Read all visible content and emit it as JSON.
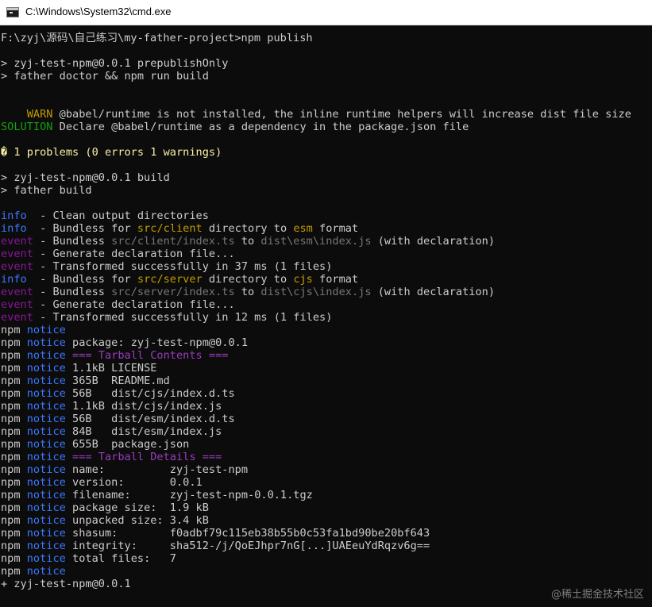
{
  "window": {
    "title": "C:\\Windows\\System32\\cmd.exe",
    "icon": "cmd-app-icon"
  },
  "colors": {
    "default": "#cccccc",
    "info": "#3b78ff",
    "event": "#881798",
    "warn": "#c19c00",
    "solution": "#13a10e",
    "notice": "#3b78ff",
    "tarball": "#9a3bbf",
    "path": "#767676",
    "warn_icon": "#f9f1a5"
  },
  "terminal": {
    "lines": [
      [
        {
          "t": "F:\\zyj\\源码\\自己练习\\my-father-project>npm publish"
        }
      ],
      [],
      [
        {
          "t": "> zyj-test-npm@0.0.1 prepublishOnly"
        }
      ],
      [
        {
          "t": "> father doctor && npm run build"
        }
      ],
      [],
      [],
      [
        {
          "t": "    WARN",
          "c": "warn"
        },
        {
          "t": " @babel/runtime is not installed, the inline runtime helpers will increase dist file size"
        }
      ],
      [
        {
          "t": "SOLUTION",
          "c": "solution"
        },
        {
          "t": " Declare @babel/runtime as a dependency in the package.json file"
        }
      ],
      [],
      [
        {
          "t": "�",
          "c": "warn_icon"
        },
        {
          "t": " 1 problems (0 errors 1 warnings)",
          "c": "warn_icon"
        }
      ],
      [],
      [
        {
          "t": "> zyj-test-npm@0.0.1 build"
        }
      ],
      [
        {
          "t": "> father build"
        }
      ],
      [],
      [
        {
          "t": "info",
          "c": "info"
        },
        {
          "t": "  - Clean output directories"
        }
      ],
      [
        {
          "t": "info",
          "c": "info"
        },
        {
          "t": "  - Bundless for "
        },
        {
          "t": "src/client",
          "c": "warn"
        },
        {
          "t": " directory to "
        },
        {
          "t": "esm",
          "c": "warn"
        },
        {
          "t": " format"
        }
      ],
      [
        {
          "t": "event",
          "c": "event"
        },
        {
          "t": " - Bundless "
        },
        {
          "t": "src/client/index.ts",
          "c": "path"
        },
        {
          "t": " to "
        },
        {
          "t": "dist\\esm\\index.js",
          "c": "path"
        },
        {
          "t": " (with declaration)"
        }
      ],
      [
        {
          "t": "event",
          "c": "event"
        },
        {
          "t": " - Generate declaration file..."
        }
      ],
      [
        {
          "t": "event",
          "c": "event"
        },
        {
          "t": " - Transformed successfully in 37 ms (1 files)"
        }
      ],
      [
        {
          "t": "info",
          "c": "info"
        },
        {
          "t": "  - Bundless for "
        },
        {
          "t": "src/server",
          "c": "warn"
        },
        {
          "t": " directory to "
        },
        {
          "t": "cjs",
          "c": "warn"
        },
        {
          "t": " format"
        }
      ],
      [
        {
          "t": "event",
          "c": "event"
        },
        {
          "t": " - Bundless "
        },
        {
          "t": "src/server/index.ts",
          "c": "path"
        },
        {
          "t": " to "
        },
        {
          "t": "dist\\cjs\\index.js",
          "c": "path"
        },
        {
          "t": " (with declaration)"
        }
      ],
      [
        {
          "t": "event",
          "c": "event"
        },
        {
          "t": " - Generate declaration file..."
        }
      ],
      [
        {
          "t": "event",
          "c": "event"
        },
        {
          "t": " - Transformed successfully in 12 ms (1 files)"
        }
      ],
      [
        {
          "t": "npm "
        },
        {
          "t": "notice",
          "c": "notice"
        }
      ],
      [
        {
          "t": "npm "
        },
        {
          "t": "notice",
          "c": "notice"
        },
        {
          "t": " package: zyj-test-npm@0.0.1"
        }
      ],
      [
        {
          "t": "npm "
        },
        {
          "t": "notice",
          "c": "notice"
        },
        {
          "t": " === Tarball Contents ===",
          "c": "tarball"
        }
      ],
      [
        {
          "t": "npm "
        },
        {
          "t": "notice",
          "c": "notice"
        },
        {
          "t": " 1.1kB LICENSE"
        }
      ],
      [
        {
          "t": "npm "
        },
        {
          "t": "notice",
          "c": "notice"
        },
        {
          "t": " 365B  README.md"
        }
      ],
      [
        {
          "t": "npm "
        },
        {
          "t": "notice",
          "c": "notice"
        },
        {
          "t": " 56B   dist/cjs/index.d.ts"
        }
      ],
      [
        {
          "t": "npm "
        },
        {
          "t": "notice",
          "c": "notice"
        },
        {
          "t": " 1.1kB dist/cjs/index.js"
        }
      ],
      [
        {
          "t": "npm "
        },
        {
          "t": "notice",
          "c": "notice"
        },
        {
          "t": " 56B   dist/esm/index.d.ts"
        }
      ],
      [
        {
          "t": "npm "
        },
        {
          "t": "notice",
          "c": "notice"
        },
        {
          "t": " 84B   dist/esm/index.js"
        }
      ],
      [
        {
          "t": "npm "
        },
        {
          "t": "notice",
          "c": "notice"
        },
        {
          "t": " 655B  package.json"
        }
      ],
      [
        {
          "t": "npm "
        },
        {
          "t": "notice",
          "c": "notice"
        },
        {
          "t": " === Tarball Details ===",
          "c": "tarball"
        }
      ],
      [
        {
          "t": "npm "
        },
        {
          "t": "notice",
          "c": "notice"
        },
        {
          "t": " name:          zyj-test-npm"
        }
      ],
      [
        {
          "t": "npm "
        },
        {
          "t": "notice",
          "c": "notice"
        },
        {
          "t": " version:       0.0.1"
        }
      ],
      [
        {
          "t": "npm "
        },
        {
          "t": "notice",
          "c": "notice"
        },
        {
          "t": " filename:      zyj-test-npm-0.0.1.tgz"
        }
      ],
      [
        {
          "t": "npm "
        },
        {
          "t": "notice",
          "c": "notice"
        },
        {
          "t": " package size:  1.9 kB"
        }
      ],
      [
        {
          "t": "npm "
        },
        {
          "t": "notice",
          "c": "notice"
        },
        {
          "t": " unpacked size: 3.4 kB"
        }
      ],
      [
        {
          "t": "npm "
        },
        {
          "t": "notice",
          "c": "notice"
        },
        {
          "t": " shasum:        f0adbf79c115eb38b55b0c53fa1bd90be20bf643"
        }
      ],
      [
        {
          "t": "npm "
        },
        {
          "t": "notice",
          "c": "notice"
        },
        {
          "t": " integrity:     sha512-/j/QoEJhpr7nG[...]UAEeuYdRqzv6g=="
        }
      ],
      [
        {
          "t": "npm "
        },
        {
          "t": "notice",
          "c": "notice"
        },
        {
          "t": " total files:   7"
        }
      ],
      [
        {
          "t": "npm "
        },
        {
          "t": "notice",
          "c": "notice"
        }
      ],
      [
        {
          "t": "+ zyj-test-npm@0.0.1"
        }
      ]
    ]
  },
  "watermark": "@稀土掘金技术社区"
}
